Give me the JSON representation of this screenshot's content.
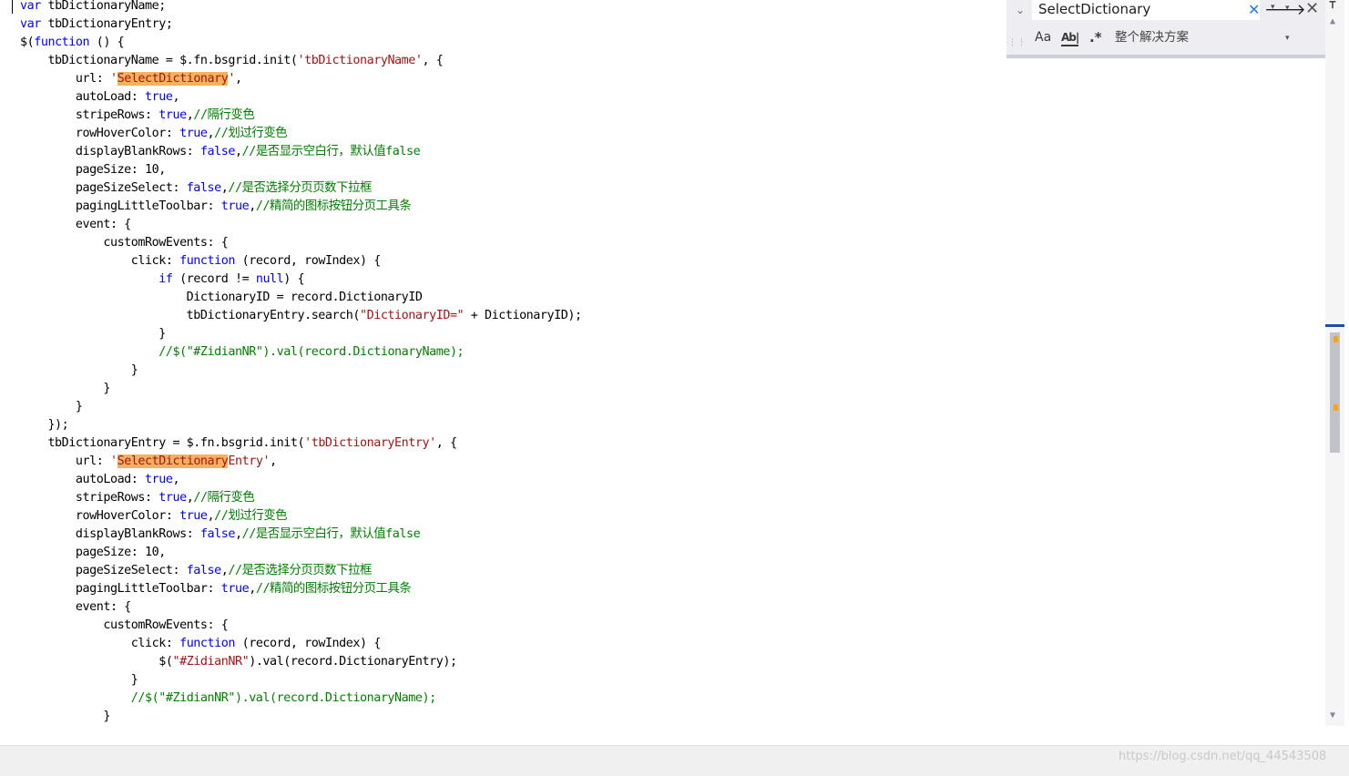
{
  "editor": {
    "lines": [
      [
        [
          "var",
          "kw"
        ],
        [
          " tbDictionaryName;",
          ""
        ]
      ],
      [
        [
          "var",
          "kw"
        ],
        [
          " tbDictionaryEntry;",
          ""
        ]
      ],
      [
        [
          "$(",
          ""
        ],
        [
          "function",
          "kw"
        ],
        [
          " () {",
          ""
        ]
      ],
      [
        [
          "    tbDictionaryName = $.fn.bsgrid.init(",
          ""
        ],
        [
          "'tbDictionaryName'",
          "str"
        ],
        [
          ", {",
          ""
        ]
      ],
      [
        [
          "        url: ",
          ""
        ],
        [
          "'",
          "str"
        ],
        [
          "SelectDictionary",
          "str hl"
        ],
        [
          "'",
          "str"
        ],
        [
          ",",
          ""
        ]
      ],
      [
        [
          "        autoLoad: ",
          ""
        ],
        [
          "true",
          "kw"
        ],
        [
          ",",
          ""
        ]
      ],
      [
        [
          "        stripeRows: ",
          ""
        ],
        [
          "true",
          "kw"
        ],
        [
          ",",
          ""
        ],
        [
          "//隔行变色",
          "cm"
        ]
      ],
      [
        [
          "        rowHoverColor: ",
          ""
        ],
        [
          "true",
          "kw"
        ],
        [
          ",",
          ""
        ],
        [
          "//划过行变色",
          "cm"
        ]
      ],
      [
        [
          "        displayBlankRows: ",
          ""
        ],
        [
          "false",
          "kw"
        ],
        [
          ",",
          ""
        ],
        [
          "//是否显示空白行，默认值false",
          "cm"
        ]
      ],
      [
        [
          "        pageSize: 10,",
          ""
        ]
      ],
      [
        [
          "        pageSizeSelect: ",
          ""
        ],
        [
          "false",
          "kw"
        ],
        [
          ",",
          ""
        ],
        [
          "//是否选择分页页数下拉框",
          "cm"
        ]
      ],
      [
        [
          "        pagingLittleToolbar: ",
          ""
        ],
        [
          "true",
          "kw"
        ],
        [
          ",",
          ""
        ],
        [
          "//精简的图标按钮分页工具条",
          "cm"
        ]
      ],
      [
        [
          "        event: {",
          ""
        ]
      ],
      [
        [
          "            customRowEvents: {",
          ""
        ]
      ],
      [
        [
          "                click: ",
          ""
        ],
        [
          "function",
          "kw"
        ],
        [
          " (record, rowIndex) {",
          ""
        ]
      ],
      [
        [
          "                    ",
          ""
        ],
        [
          "if",
          "kw"
        ],
        [
          " (record != ",
          ""
        ],
        [
          "null",
          "kw"
        ],
        [
          ") {",
          ""
        ]
      ],
      [
        [
          "                        DictionaryID = record.DictionaryID",
          ""
        ]
      ],
      [
        [
          "                        tbDictionaryEntry.search(",
          ""
        ],
        [
          "\"DictionaryID=\"",
          "str"
        ],
        [
          " + DictionaryID);",
          ""
        ]
      ],
      [
        [
          "                    }",
          ""
        ]
      ],
      [
        [
          "                    ",
          ""
        ],
        [
          "//$(\"#ZidianNR\").val(record.DictionaryName);",
          "cm"
        ]
      ],
      [
        [
          "                }",
          ""
        ]
      ],
      [
        [
          "            }",
          ""
        ]
      ],
      [
        [
          "        }",
          ""
        ]
      ],
      [
        [
          "    });",
          ""
        ]
      ],
      [
        [
          "    tbDictionaryEntry = $.fn.bsgrid.init(",
          ""
        ],
        [
          "'tbDictionaryEntry'",
          "str"
        ],
        [
          ", {",
          ""
        ]
      ],
      [
        [
          "        url: ",
          ""
        ],
        [
          "'",
          "str"
        ],
        [
          "SelectDictionary",
          "str hl"
        ],
        [
          "Entry'",
          "str"
        ],
        [
          ",",
          ""
        ]
      ],
      [
        [
          "        autoLoad: ",
          ""
        ],
        [
          "true",
          "kw"
        ],
        [
          ",",
          ""
        ]
      ],
      [
        [
          "        stripeRows: ",
          ""
        ],
        [
          "true",
          "kw"
        ],
        [
          ",",
          ""
        ],
        [
          "//隔行变色",
          "cm"
        ]
      ],
      [
        [
          "        rowHoverColor: ",
          ""
        ],
        [
          "true",
          "kw"
        ],
        [
          ",",
          ""
        ],
        [
          "//划过行变色",
          "cm"
        ]
      ],
      [
        [
          "        displayBlankRows: ",
          ""
        ],
        [
          "false",
          "kw"
        ],
        [
          ",",
          ""
        ],
        [
          "//是否显示空白行，默认值false",
          "cm"
        ]
      ],
      [
        [
          "        pageSize: 10,",
          ""
        ]
      ],
      [
        [
          "        pageSizeSelect: ",
          ""
        ],
        [
          "false",
          "kw"
        ],
        [
          ",",
          ""
        ],
        [
          "//是否选择分页页数下拉框",
          "cm"
        ]
      ],
      [
        [
          "        pagingLittleToolbar: ",
          ""
        ],
        [
          "true",
          "kw"
        ],
        [
          ",",
          ""
        ],
        [
          "//精简的图标按钮分页工具条",
          "cm"
        ]
      ],
      [
        [
          "        event: {",
          ""
        ]
      ],
      [
        [
          "            customRowEvents: {",
          ""
        ]
      ],
      [
        [
          "                click: ",
          ""
        ],
        [
          "function",
          "kw"
        ],
        [
          " (record, rowIndex) {",
          ""
        ]
      ],
      [
        [
          "                    $(",
          ""
        ],
        [
          "\"#ZidianNR\"",
          "str"
        ],
        [
          ").val(record.DictionaryEntry);",
          ""
        ]
      ],
      [
        [
          "                }",
          ""
        ]
      ],
      [
        [
          "                ",
          ""
        ],
        [
          "//$(\"#ZidianNR\").val(record.DictionaryName);",
          "cm"
        ]
      ],
      [
        [
          "            }",
          ""
        ]
      ]
    ]
  },
  "find": {
    "search_value": "SelectDictionary",
    "clear_icon": "✕",
    "history_icon": "▾",
    "next_icon": "🡒",
    "next_dropdown_icon": "▾",
    "close_icon": "✕",
    "match_case_label": "Aa",
    "whole_word_label": "Ab|",
    "regex_label": ".*",
    "scope_label": "整个解决方案",
    "scope_dropdown_icon": "▾",
    "toggle_icon": "⌄"
  },
  "watermark": "https://blog.csdn.net/qq_44543508",
  "colors": {
    "keyword": "#0000ff",
    "string": "#a31515",
    "comment": "#008000",
    "highlight": "#f7b05e",
    "scroll_mark": "#f7a41d"
  }
}
